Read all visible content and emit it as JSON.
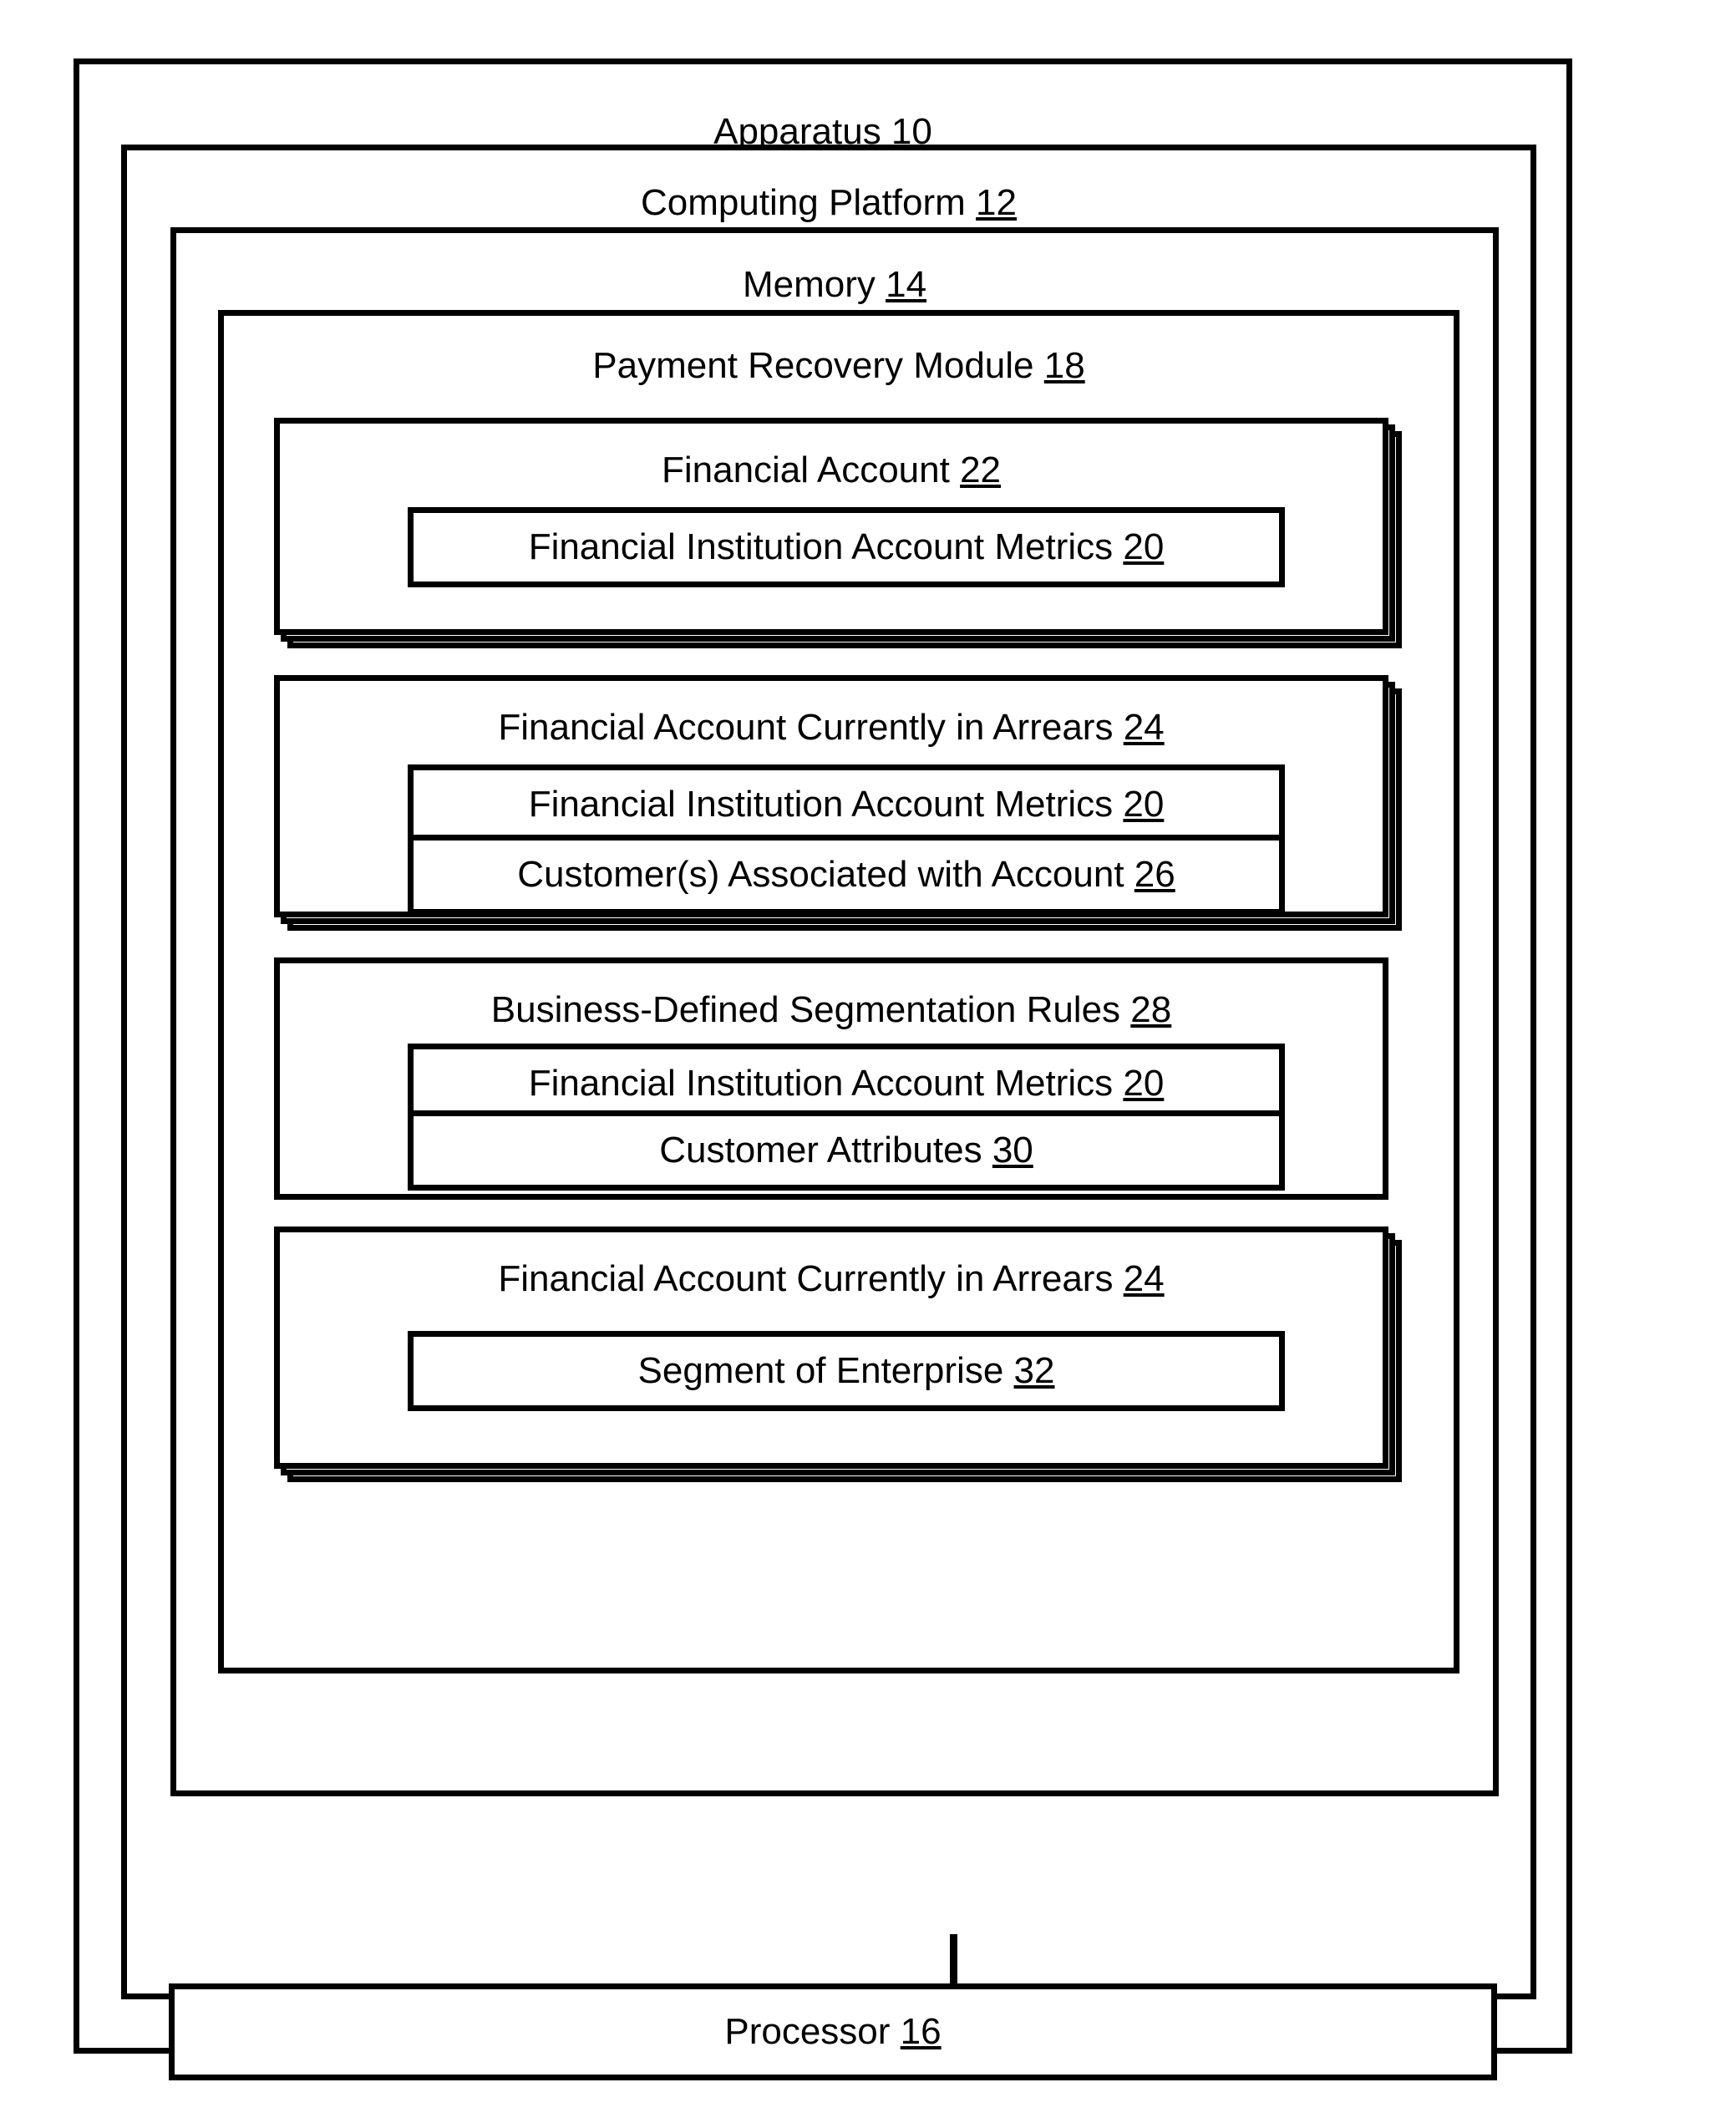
{
  "diagram": {
    "apparatus": {
      "label": "Apparatus",
      "ref": "10"
    },
    "computing_platform": {
      "label": "Computing Platform",
      "ref": "12"
    },
    "memory": {
      "label": "Memory",
      "ref": "14"
    },
    "processor": {
      "label": "Processor",
      "ref": "16"
    },
    "payment_recovery_module": {
      "label": "Payment Recovery Module",
      "ref": "18"
    },
    "cards": [
      {
        "title": "Financial Account",
        "ref": "22",
        "stacked": true,
        "items": [
          {
            "label": "Financial Institution Account Metrics",
            "ref": "20"
          }
        ]
      },
      {
        "title": "Financial Account Currently in Arrears",
        "ref": "24",
        "stacked": true,
        "items": [
          {
            "label": "Financial Institution Account Metrics",
            "ref": "20"
          },
          {
            "label": "Customer(s) Associated with Account",
            "ref": "26"
          }
        ]
      },
      {
        "title": "Business-Defined Segmentation Rules",
        "ref": "28",
        "stacked": false,
        "items": [
          {
            "label": "Financial Institution Account Metrics",
            "ref": "20"
          },
          {
            "label": "Customer Attributes",
            "ref": "30"
          }
        ]
      },
      {
        "title": "Financial Account Currently in Arrears",
        "ref": "24",
        "stacked": true,
        "items": [
          {
            "label": "Segment of Enterprise",
            "ref": "32"
          }
        ]
      }
    ]
  },
  "style": {
    "stroke_color": "#000000",
    "background_color": "#ffffff"
  }
}
